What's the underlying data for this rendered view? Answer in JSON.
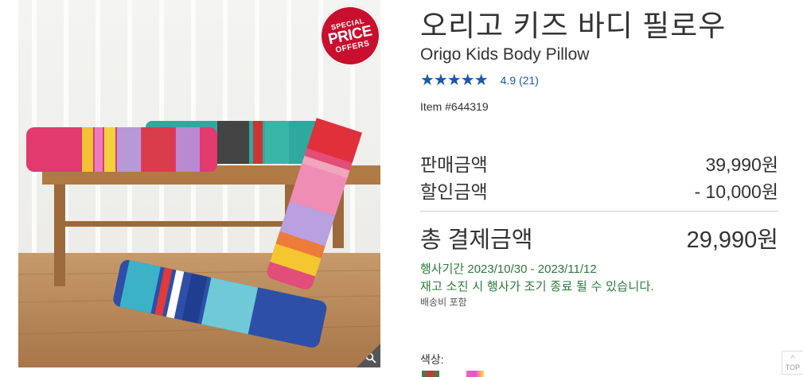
{
  "badge": {
    "line1": "SPECIAL",
    "line2": "PRICE",
    "line3": "OFFERS"
  },
  "product": {
    "title_ko": "오리고 키즈 바디 필로우",
    "title_en": "Origo Kids Body Pillow",
    "stars": "★★★★★",
    "rating": "4.9 (21)",
    "item_number": "Item #644319"
  },
  "pricing": {
    "sale_label": "판매금액",
    "sale_value": "39,990원",
    "discount_label": "할인금액",
    "discount_value": "- 10,000원",
    "total_label": "총 결제금액",
    "total_value": "29,990원"
  },
  "promo": {
    "period": "행사기간 2023/10/30 - 2023/11/12",
    "notice": "재고 소진 시 행사가 조기 종료 될 수 있습니다.",
    "shipping": "배송비 포함"
  },
  "options": {
    "color_label": "색상:"
  },
  "scroll_top": {
    "label": "TOP",
    "arrow": "^"
  },
  "colors": {
    "rating_blue": "#1a5aa8",
    "promo_green": "#2c7a3a",
    "badge_red": "#c8102e"
  },
  "icons": [
    "zoom-icon",
    "star-icon",
    "scroll-top-icon"
  ]
}
